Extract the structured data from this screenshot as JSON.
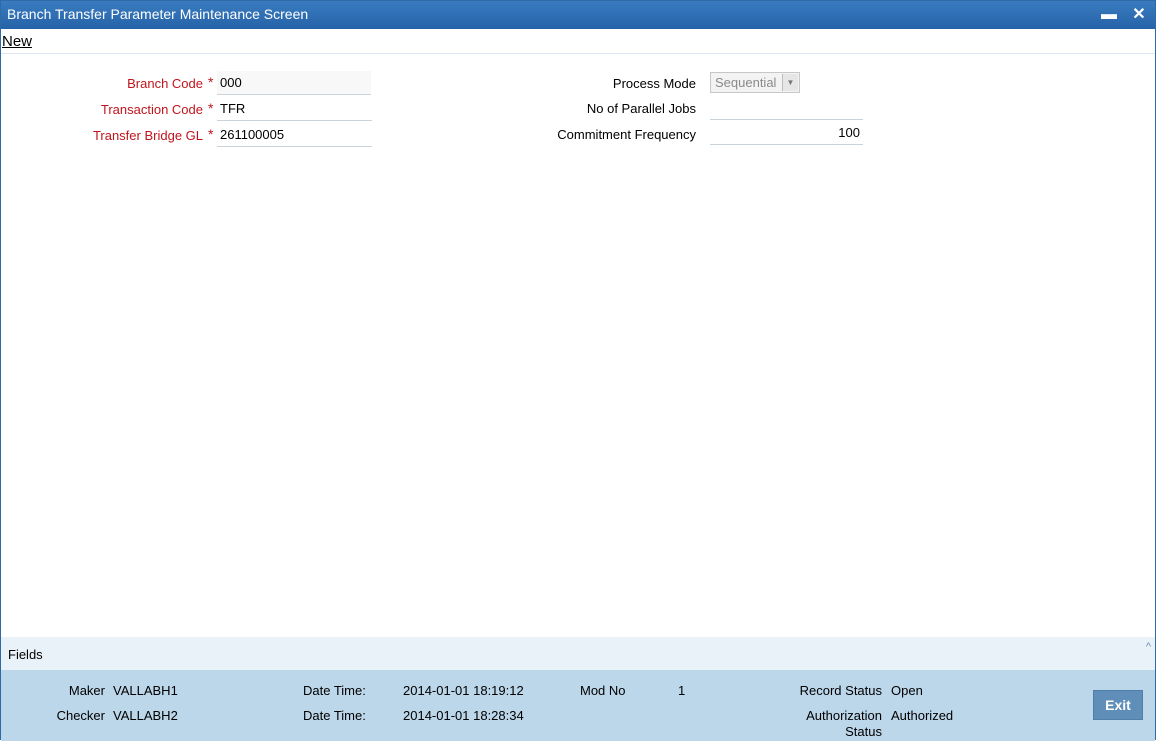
{
  "window": {
    "title": "Branch Transfer Parameter Maintenance Screen",
    "minimize_glyph": "▬",
    "close_glyph": "✕"
  },
  "menu": {
    "new_label": "New"
  },
  "form": {
    "branch_code_label": "Branch Code",
    "branch_code_value": "000",
    "transaction_code_label": "Transaction Code",
    "transaction_code_value": "TFR",
    "transfer_bridge_gl_label": "Transfer Bridge GL",
    "transfer_bridge_gl_value": "261100005",
    "required_marker": "*",
    "process_mode_label": "Process Mode",
    "process_mode_value": "Sequential",
    "parallel_jobs_label": "No of Parallel Jobs",
    "parallel_jobs_value": "",
    "commitment_frequency_label": "Commitment Frequency",
    "commitment_frequency_value": "100"
  },
  "fields_bar": {
    "label": "Fields",
    "caret": "^"
  },
  "footer": {
    "maker_label": "Maker",
    "maker_value": "VALLABH1",
    "checker_label": "Checker",
    "checker_value": "VALLABH2",
    "date_time_label_1": "Date Time:",
    "date_time_value_1": "2014-01-01 18:19:12",
    "date_time_label_2": "Date Time:",
    "date_time_value_2": "2014-01-01 18:28:34",
    "mod_no_label": "Mod No",
    "mod_no_value": "1",
    "record_status_label": "Record Status",
    "record_status_value": "Open",
    "auth_status_label_line1": "Authorization",
    "auth_status_label_line2": "Status",
    "auth_status_value": "Authorized",
    "exit_label": "Exit"
  },
  "colors": {
    "titlebar": "#2563a8",
    "required_label": "#c0141c",
    "footer_bg": "#bcd6ea",
    "fields_bar_bg": "#eaf2f9",
    "exit_button": "#5f8fb8"
  }
}
